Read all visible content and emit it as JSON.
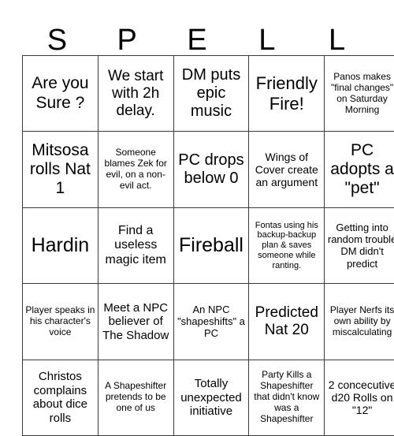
{
  "card": {
    "header_letters": [
      "S",
      "P",
      "E",
      "L",
      "L"
    ],
    "grid": {
      "columns": 5,
      "rows": 5,
      "border_color": "#3a3a3a",
      "background_color": "#ffffff",
      "text_color": "#000000"
    },
    "cells": [
      {
        "text": "Are you Sure ?",
        "font_size": "21px"
      },
      {
        "text": "We start with 2h delay.",
        "font_size": "19px"
      },
      {
        "text": "DM puts epic music",
        "font_size": "20px"
      },
      {
        "text": "Friendly Fire!",
        "font_size": "22px"
      },
      {
        "text": "Panos makes \"final changes\" on Saturday Morning",
        "font_size": "12px"
      },
      {
        "text": "Mitsosa rolls Nat 1",
        "font_size": "21px"
      },
      {
        "text": "Someone blames Zek for evil, on a non-evil act.",
        "font_size": "12px"
      },
      {
        "text": "PC drops below 0",
        "font_size": "20px"
      },
      {
        "text": "Wings of Cover create an argument",
        "font_size": "14px"
      },
      {
        "text": "PC adopts a \"pet\"",
        "font_size": "21px"
      },
      {
        "text": "Hardin",
        "font_size": "25px"
      },
      {
        "text": "Find a useless magic item",
        "font_size": "16px"
      },
      {
        "text": "Fireball",
        "font_size": "25px"
      },
      {
        "text": "Fontas using his backup-backup plan & saves someone while ranting.",
        "font_size": "11px"
      },
      {
        "text": "Getting into random trouble DM didn't predict",
        "font_size": "13px"
      },
      {
        "text": "Player speaks in his character's voice",
        "font_size": "12px"
      },
      {
        "text": "Meet a NPC believer of The Shadow",
        "font_size": "15px"
      },
      {
        "text": "An NPC \"shapeshifts\" a PC",
        "font_size": "13px"
      },
      {
        "text": "Predicted Nat 20",
        "font_size": "19px"
      },
      {
        "text": "Player Nerfs its own ability by miscalculating",
        "font_size": "12px"
      },
      {
        "text": "Christos complains about dice rolls",
        "font_size": "15px"
      },
      {
        "text": "A Shapeshifter pretends to be one of us",
        "font_size": "12px"
      },
      {
        "text": "Totally unexpected initiative",
        "font_size": "15px"
      },
      {
        "text": "Party Kills a Shapeshifter that didn't know was a Shapeshifter",
        "font_size": "12px"
      },
      {
        "text": "2 concecutive d20 Rolls on \"12\"",
        "font_size": "14px"
      }
    ]
  }
}
